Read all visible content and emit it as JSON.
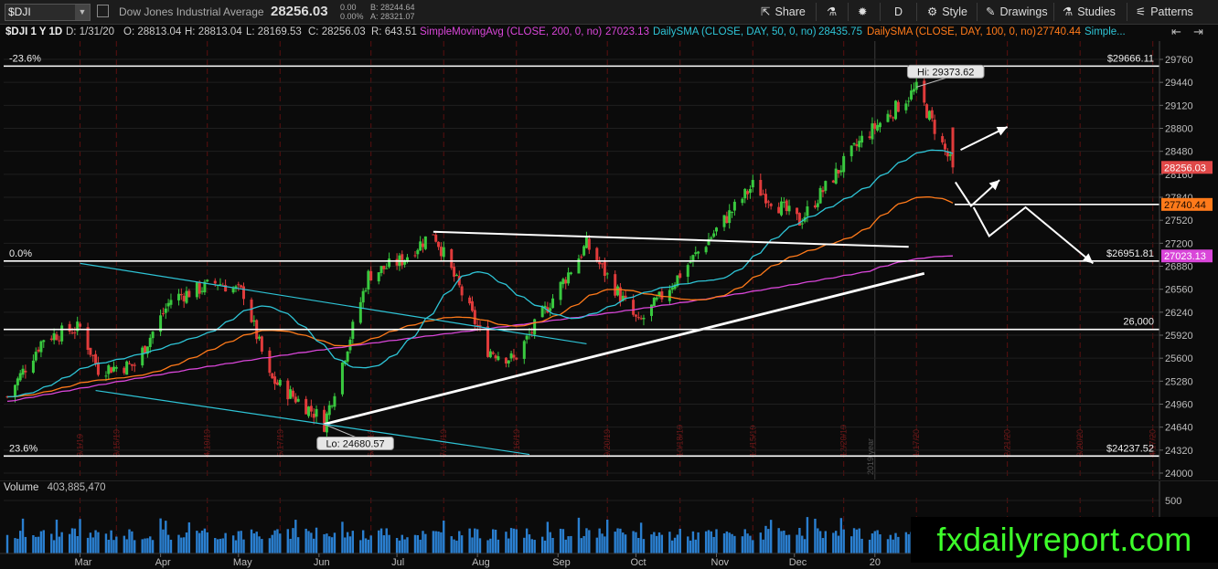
{
  "toolbar": {
    "symbol": "$DJI",
    "symbol_name": "Dow Jones Industrial Average",
    "last": "28256.03",
    "change_net": "0.00",
    "change_pct": "0.00%",
    "bid": "B: 28244.64",
    "ask": "A: 28321.07",
    "buttons": {
      "share": "Share",
      "timeframe": "D",
      "style": "Style",
      "drawings": "Drawings",
      "studies": "Studies",
      "patterns": "Patterns"
    }
  },
  "info_bar": {
    "symbol_period": "$DJI 1 Y 1D",
    "date": "D: 1/31/20",
    "open": "O: 28813.04",
    "high": "H: 28813.04",
    "low": "L: 28169.53",
    "close": "C: 28256.03",
    "range": "R: 643.51",
    "sma200_label": "SimpleMovingAvg (CLOSE, 200, 0, no)",
    "sma200_value": "27023.13",
    "sma50_label": "DailySMA (CLOSE, DAY, 50, 0, no)",
    "sma50_value": "28435.75",
    "sma100_label": "DailySMA (CLOSE, DAY, 100, 0, no)",
    "sma100_value": "27740.44",
    "more_label": "Simple...",
    "colors": {
      "sma200": "#d946d9",
      "sma50": "#2ec4d6",
      "sma100": "#ff7a1a"
    }
  },
  "price_axis_labels": {
    "hi": "Hi: 29373.62",
    "lo": "Lo: 24680.57",
    "last_badge": "28256.03",
    "sma100_badge": "27740.44",
    "sma200_badge": "27023.13"
  },
  "fib_levels": [
    {
      "left_label": "-23.6%",
      "right_label": "$29666.11",
      "value": 29666.11
    },
    {
      "left_label": "0.0%",
      "right_label": "$26951.81",
      "value": 26951.81
    },
    {
      "left_label": "",
      "right_label": "26,000",
      "value": 26000
    },
    {
      "left_label": "23.6%",
      "right_label": "$24237.52",
      "value": 24237.52
    }
  ],
  "volume": {
    "label": "Volume",
    "value": "403,885,470",
    "axis_label": "500"
  },
  "months": [
    "Mar",
    "Apr",
    "May",
    "Jun",
    "Jul",
    "Aug",
    "Sep",
    "Oct",
    "Nov",
    "Dec",
    "20"
  ],
  "year_marker": "2019 year",
  "vertical_date_tags": [
    "3/1/19",
    "3/15/19",
    "4/19/19",
    "5/17/19",
    "6/21/19",
    "7/19/19",
    "8/16/19",
    "9/20/19",
    "10/18/19",
    "11/15/19",
    "12/20/19",
    "1/17/20",
    "2/21/20",
    "3/20/20",
    "4/17/20"
  ],
  "brand": "fxdailyreport.com",
  "chart_data": {
    "type": "candlestick",
    "title": "Dow Jones Industrial Average",
    "period": "1 Y, daily",
    "ylim": [
      24000,
      29900
    ],
    "y_ticks": [
      24000,
      24320,
      24640,
      24960,
      25280,
      25600,
      25920,
      26240,
      26560,
      26880,
      27200,
      27520,
      27840,
      28160,
      28480,
      28800,
      29120,
      29440,
      29760
    ],
    "x_categories": [
      "Mar",
      "Apr",
      "May",
      "Jun",
      "Jul",
      "Aug",
      "Sep",
      "Oct",
      "Nov",
      "Dec",
      "20"
    ],
    "close_series_approx": [
      {
        "x": "2019-02-01",
        "close": 25064
      },
      {
        "x": "2019-02-15",
        "close": 25883
      },
      {
        "x": "2019-03-01",
        "close": 26026
      },
      {
        "x": "2019-03-08",
        "close": 25450
      },
      {
        "x": "2019-03-22",
        "close": 25502
      },
      {
        "x": "2019-04-05",
        "close": 26424
      },
      {
        "x": "2019-04-23",
        "close": 26656
      },
      {
        "x": "2019-05-03",
        "close": 26505
      },
      {
        "x": "2019-05-13",
        "close": 25325
      },
      {
        "x": "2019-05-31",
        "close": 24815
      },
      {
        "x": "2019-06-03",
        "close": 24680
      },
      {
        "x": "2019-06-20",
        "close": 26753
      },
      {
        "x": "2019-07-03",
        "close": 26966
      },
      {
        "x": "2019-07-15",
        "close": 27359
      },
      {
        "x": "2019-08-05",
        "close": 25717
      },
      {
        "x": "2019-08-15",
        "close": 25579
      },
      {
        "x": "2019-09-12",
        "close": 27182
      },
      {
        "x": "2019-10-02",
        "close": 26078
      },
      {
        "x": "2019-10-18",
        "close": 26770
      },
      {
        "x": "2019-11-15",
        "close": 28004
      },
      {
        "x": "2019-12-03",
        "close": 27502
      },
      {
        "x": "2019-12-27",
        "close": 28645
      },
      {
        "x": "2020-01-17",
        "close": 29348
      },
      {
        "x": "2020-01-31",
        "close": 28256
      }
    ],
    "ohlc_last": {
      "date": "1/31/20",
      "open": 28813.04,
      "high": 28813.04,
      "low": 28169.53,
      "close": 28256.03
    },
    "period_high": 29373.62,
    "period_low": 24680.57,
    "moving_averages": [
      {
        "name": "SMA 50",
        "value": 28435.75
      },
      {
        "name": "SMA 100",
        "value": 27740.44
      },
      {
        "name": "SMA 200",
        "value": 27023.13
      }
    ],
    "fibonacci": [
      {
        "label": "-23.6%",
        "value": 29666.11
      },
      {
        "label": "0.0%",
        "value": 26951.81
      },
      {
        "label": "23.6%",
        "value": 24237.52
      }
    ],
    "horizontal_lines": [
      26000,
      27740.44
    ],
    "volume_last": 403885470,
    "grid": true,
    "legend": "top"
  }
}
